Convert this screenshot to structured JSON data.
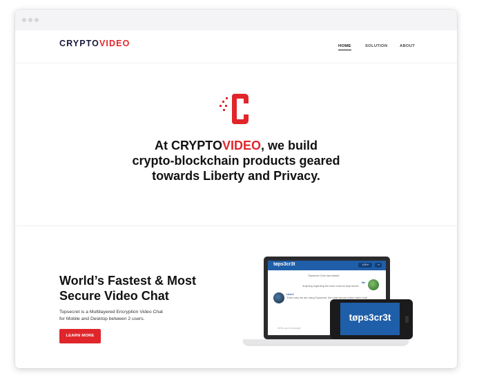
{
  "header": {
    "logo_part1": "CRYPTO",
    "logo_part2": "VIDEO",
    "nav": [
      "HOME",
      "SOLUTION",
      "ABOUT"
    ]
  },
  "hero": {
    "line1_pre": "At ",
    "line1_brand1": "CRYPTO",
    "line1_brand2": "VIDEO",
    "line1_post": ", we build",
    "line2": "crypto-blockchain products geared",
    "line3": "towards Liberty and Privacy."
  },
  "feature": {
    "title_line1": "World’s Fastest & Most",
    "title_line2": "Secure Video Chat",
    "desc_line1": "Topsecret is a Multilayered Encryption Video Chat",
    "desc_line2": "for Mobile and Desktop between 2 users.",
    "button": "LEARN MORE"
  },
  "device": {
    "laptop_brand": "tøps3cr3t",
    "pill1": "1:05 ▾",
    "pill2": "⇥",
    "chat_status": "Topsecret Chat has started",
    "chat_me_name": "Me",
    "chat_me_msg": "Anything regarding the work must be kept secret.",
    "chat_user_name": "User2",
    "chat_user_msg": "That's why we are using Topsecret, the most secure online video chat.",
    "input_placeholder": "Write your message",
    "phone_brand": "tøps3cr3t"
  },
  "colors": {
    "brand_red": "#e0262b",
    "brand_navy": "#17193b",
    "app_blue": "#1f5ea8"
  }
}
